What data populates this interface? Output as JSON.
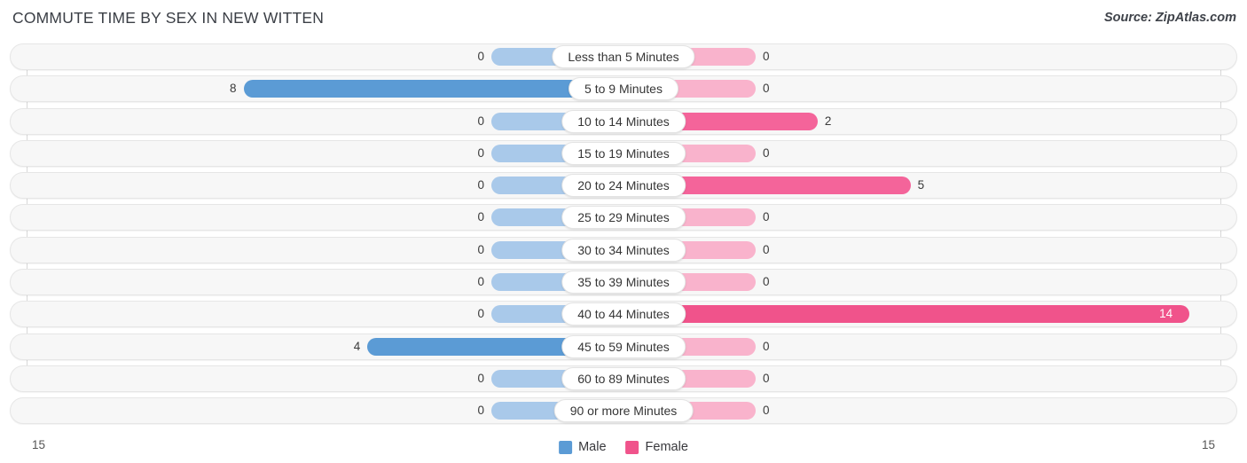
{
  "header": {
    "title": "COMMUTE TIME BY SEX IN NEW WITTEN",
    "source": "Source: ZipAtlas.com"
  },
  "axis": {
    "left_label": "15",
    "right_label": "15"
  },
  "legend": {
    "items": [
      {
        "label": "Male",
        "color": "#5b9bd5"
      },
      {
        "label": "Female",
        "color": "#f0538b"
      }
    ]
  },
  "colors": {
    "male_strong": "#5b9bd5",
    "male_light": "#a9c9ea",
    "female_strong": "#f4649a",
    "female_max": "#f0538b",
    "female_light": "#f9b3cc",
    "track": "#f7f7f7",
    "gridline": "#d8d8d8"
  },
  "chart_data": {
    "type": "bar",
    "title": "COMMUTE TIME BY SEX IN NEW WITTEN",
    "subtitle": "Source: ZipAtlas.com",
    "orientation": "horizontal-diverging",
    "xlabel": "",
    "ylabel": "",
    "xlim": [
      15,
      15
    ],
    "axis_max": 15,
    "grid": true,
    "legend_position": "bottom-center",
    "categories": [
      "Less than 5 Minutes",
      "5 to 9 Minutes",
      "10 to 14 Minutes",
      "15 to 19 Minutes",
      "20 to 24 Minutes",
      "25 to 29 Minutes",
      "30 to 34 Minutes",
      "35 to 39 Minutes",
      "40 to 44 Minutes",
      "45 to 59 Minutes",
      "60 to 89 Minutes",
      "90 or more Minutes"
    ],
    "series": [
      {
        "name": "Male",
        "values": [
          0,
          8,
          0,
          0,
          0,
          0,
          0,
          0,
          0,
          4,
          0,
          0
        ]
      },
      {
        "name": "Female",
        "values": [
          0,
          0,
          2,
          0,
          5,
          0,
          0,
          0,
          14,
          0,
          0,
          0
        ]
      }
    ]
  },
  "rows": [
    {
      "category": "Less than 5 Minutes",
      "male": "0",
      "female": "0"
    },
    {
      "category": "5 to 9 Minutes",
      "male": "8",
      "female": "0"
    },
    {
      "category": "10 to 14 Minutes",
      "male": "0",
      "female": "2"
    },
    {
      "category": "15 to 19 Minutes",
      "male": "0",
      "female": "0"
    },
    {
      "category": "20 to 24 Minutes",
      "male": "0",
      "female": "5"
    },
    {
      "category": "25 to 29 Minutes",
      "male": "0",
      "female": "0"
    },
    {
      "category": "30 to 34 Minutes",
      "male": "0",
      "female": "0"
    },
    {
      "category": "35 to 39 Minutes",
      "male": "0",
      "female": "0"
    },
    {
      "category": "40 to 44 Minutes",
      "male": "0",
      "female": "14"
    },
    {
      "category": "45 to 59 Minutes",
      "male": "4",
      "female": "0"
    },
    {
      "category": "60 to 89 Minutes",
      "male": "0",
      "female": "0"
    },
    {
      "category": "90 or more Minutes",
      "male": "0",
      "female": "0"
    }
  ]
}
